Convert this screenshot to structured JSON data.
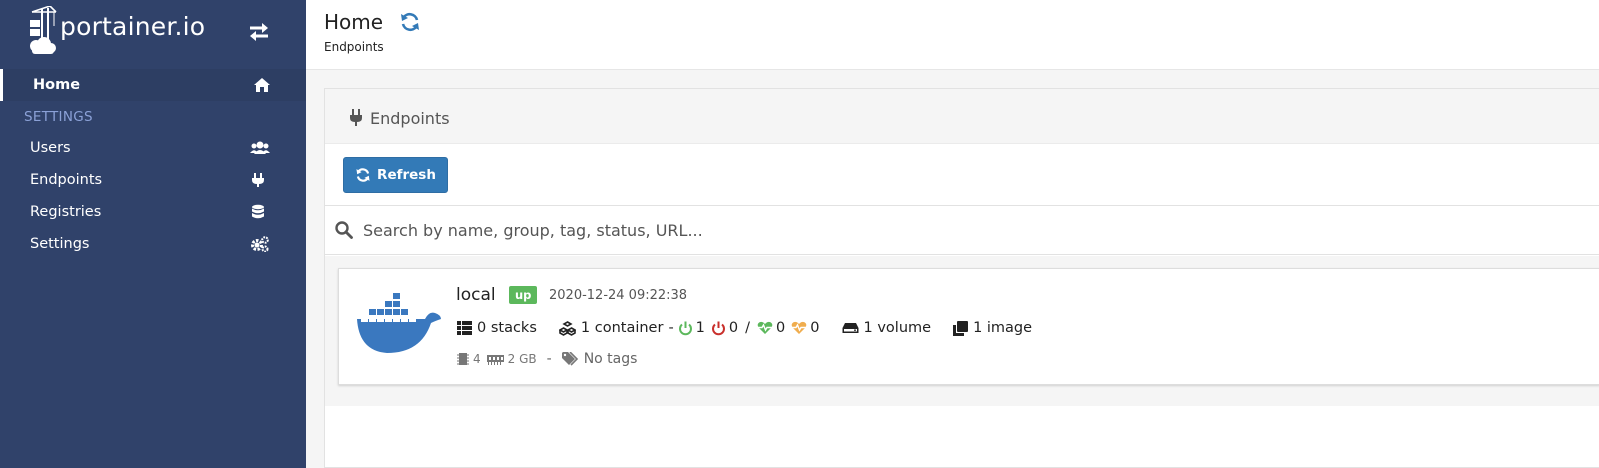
{
  "app": {
    "logo_text": "portainer.io"
  },
  "sidebar": {
    "home": {
      "label": "Home",
      "icon": "home-icon"
    },
    "section_label": "SETTINGS",
    "items": [
      {
        "label": "Users",
        "icon": "users-icon"
      },
      {
        "label": "Endpoints",
        "icon": "plug-icon"
      },
      {
        "label": "Registries",
        "icon": "database-icon"
      },
      {
        "label": "Settings",
        "icon": "cogs-icon"
      }
    ]
  },
  "header": {
    "title": "Home",
    "breadcrumb": "Endpoints"
  },
  "panel": {
    "title": "Endpoints",
    "refresh_label": "Refresh",
    "search_placeholder": "Search by name, group, tag, status, URL..."
  },
  "endpoint": {
    "name": "local",
    "status": "up",
    "timestamp": "2020-12-24 09:22:38",
    "stacks": "0 stacks",
    "containers": "1 container",
    "running": "1",
    "stopped": "0",
    "separator": "/",
    "healthy": "0",
    "unhealthy": "0",
    "volumes": "1 volume",
    "images": "1 image",
    "cpu": "4",
    "memory": "2 GB",
    "dash": "-",
    "tags": "No tags"
  },
  "colors": {
    "sidebar_bg": "#30426a",
    "accent_blue": "#337ab7",
    "status_up": "#5cb85c",
    "running_green": "#5cb85c",
    "stopped_red": "#c9302c",
    "healthy_green": "#5cb85c",
    "unhealthy_orange": "#f0ad4e",
    "section_label": "#8ba1d7"
  }
}
